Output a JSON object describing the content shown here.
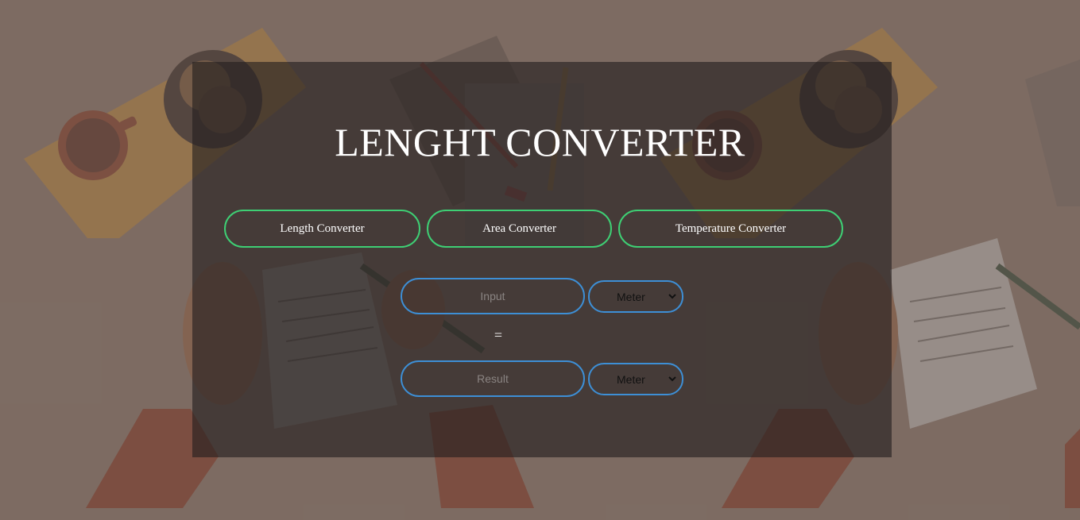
{
  "page": {
    "title": "LENGHT CONVERTER"
  },
  "tabs": [
    {
      "label": "Length Converter"
    },
    {
      "label": "Area Converter"
    },
    {
      "label": "Temperature Converter"
    }
  ],
  "converter": {
    "input": {
      "placeholder": "Input",
      "value": ""
    },
    "from_unit": {
      "selected": "Meter"
    },
    "equals_sign": "=",
    "result": {
      "placeholder": "Result",
      "value": ""
    },
    "to_unit": {
      "selected": "Meter"
    }
  },
  "colors": {
    "background": "#7d6c63",
    "panel": "#231e1e",
    "tab_border": "#3ecf74",
    "field_border": "#3d8fd6",
    "text": "#ffffff"
  },
  "background_image": {
    "description_icons": [
      "desk-illustration",
      "coffee-mug-icon",
      "cookie-plate-icon",
      "notebook-icon",
      "pencil-icon",
      "hand-icon"
    ]
  }
}
